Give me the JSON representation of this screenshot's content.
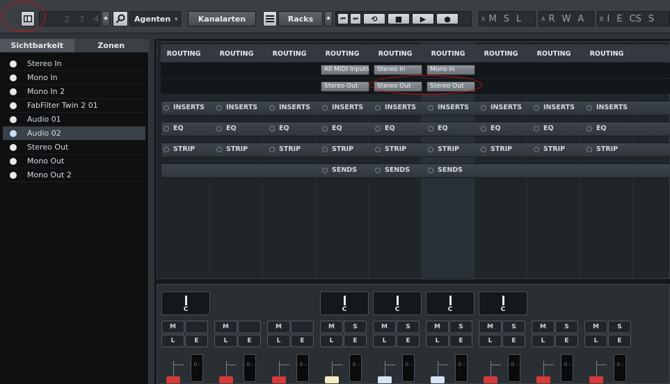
{
  "toolbar": {
    "page_numbers": [
      "2",
      "3",
      "4"
    ],
    "star": "★",
    "agents_label": "Agenten",
    "channel_types_label": "Kanalarten",
    "racks_label": "Racks",
    "transport": [
      "⏮",
      "⏭",
      "⟲",
      "■",
      "▶",
      "●"
    ],
    "group1_small": "X",
    "group1_letters": [
      "M",
      "S",
      "L"
    ],
    "group2_small": "A",
    "group2_letters": [
      "R",
      "W",
      "A"
    ],
    "group3_small": "B",
    "group3_letters": [
      "I",
      "E",
      "CS",
      "S"
    ]
  },
  "sidebar": {
    "tabs": [
      "Sichtbarkeit",
      "Zonen"
    ],
    "channels": [
      "Stereo In",
      "Mono In",
      "Mono In 2",
      "FabFilter Twin 2 01",
      "Audio 01",
      "Audio 02",
      "Stereo Out",
      "Mono Out",
      "Mono Out 2"
    ],
    "selected_index": 5
  },
  "racks": {
    "routing_label": "ROUTING",
    "inserts_label": "INSERTS",
    "eq_label": "EQ",
    "strip_label": "STRIP",
    "sends_label": "SENDS",
    "input_routing": [
      "All MIDI Inputs",
      "Stereo In",
      "Mono In"
    ],
    "output_routing": [
      "Stereo Out",
      "Stereo Out",
      "Stereo Out"
    ]
  },
  "faders": {
    "pan_label": "C",
    "mute": "M",
    "solo": "S",
    "listen": "L",
    "edit": "E",
    "zero": "– 0 –"
  },
  "colors": {
    "annotation": "#d01010",
    "fader_red": "#d63a3a",
    "fader_yellow": "#f3efc3",
    "fader_lightblue": "#d6e4f4"
  }
}
